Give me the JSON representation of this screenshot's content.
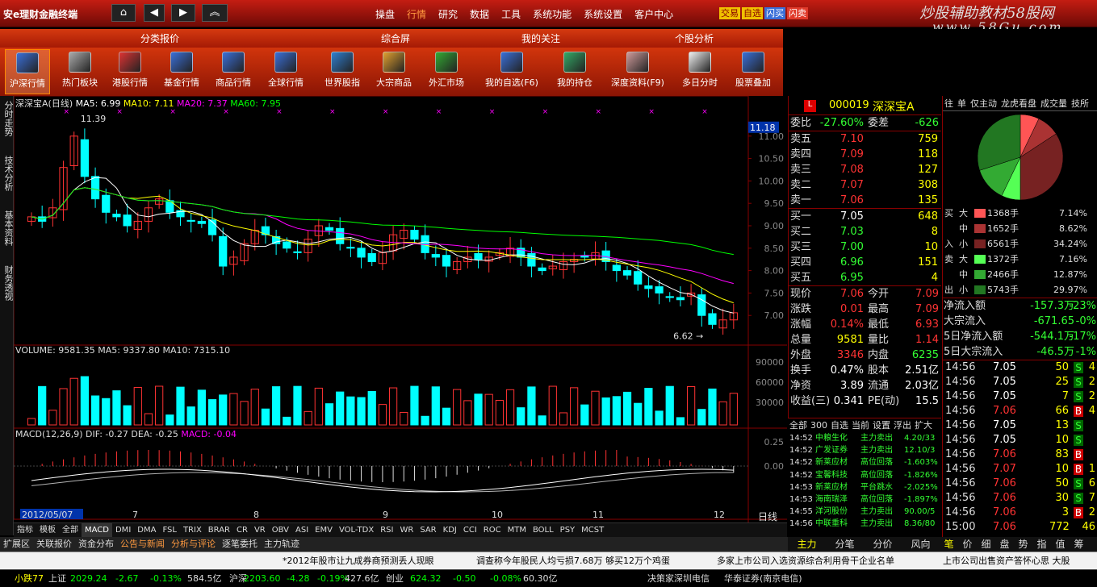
{
  "titlebar": {
    "app_title": "安e理财金融终端",
    "menu": [
      "操盘",
      "行情",
      "研究",
      "数据",
      "工具",
      "系统功能",
      "系统设置",
      "客户中心"
    ],
    "active_menu": "行情",
    "quick": [
      "交易",
      "自选",
      "闪买",
      "闪卖"
    ],
    "logo_line1": "炒股辅助教材58股网",
    "logo_line2": "www.58Gu.com"
  },
  "categories": [
    "分类报价",
    "综合屏",
    "我的关注",
    "个股分析"
  ],
  "toolbar": [
    {
      "label": "沪深行情",
      "icon": "chart-window-icon",
      "active": true
    },
    {
      "label": "热门板块",
      "icon": "funnel-icon"
    },
    {
      "label": "港股行情",
      "icon": "chart-window-icon"
    },
    {
      "label": "基金行情",
      "icon": "chart-window-icon"
    },
    {
      "label": "商品行情",
      "icon": "chart-window-icon"
    },
    {
      "label": "全球行情",
      "icon": "globe-icon"
    },
    {
      "label": "世界股指",
      "icon": "globe-chart-icon"
    },
    {
      "label": "大宗商品",
      "icon": "box-icon"
    },
    {
      "label": "外汇市场",
      "icon": "currency-icon"
    },
    {
      "label": "我的自选(F6)",
      "icon": "person-icon"
    },
    {
      "label": "我的持仓",
      "icon": "refresh-icon"
    },
    {
      "label": "深度资料(F9)",
      "icon": "document-icon"
    },
    {
      "label": "多日分时",
      "icon": "calendar-icon"
    },
    {
      "label": "股票叠加",
      "icon": "window-stack-icon"
    }
  ],
  "vtabs": [
    "分时走势",
    "技术分析",
    "基本资料",
    "财务透视"
  ],
  "chart": {
    "title": "深深宝A(日线)",
    "ma_legend": [
      {
        "label": "MA5:",
        "value": "6.99",
        "color": "#ffffff"
      },
      {
        "label": "MA10:",
        "value": "7.11",
        "color": "#ffff00"
      },
      {
        "label": "MA20:",
        "value": "7.37",
        "color": "#ff00ff"
      },
      {
        "label": "MA60:",
        "value": "7.95",
        "color": "#00ff00"
      }
    ],
    "price_axis": [
      "11.00",
      "10.50",
      "10.00",
      "9.50",
      "9.00",
      "8.50",
      "8.00",
      "7.50",
      "7.00"
    ],
    "current_price_tag": "11.18",
    "high_label": "11.39",
    "low_label": "6.62",
    "volume_title": "VOLUME: 9581.35  MA5: 9337.80  MA10: 7315.10",
    "volume_axis": [
      "90000",
      "60000",
      "30000"
    ],
    "macd_title_prefix": "MACD(12,26,9)",
    "macd_title_dif": "DIF: -0.27",
    "macd_title_dea": "DEA: -0.25",
    "macd_title_macd": "MACD: -0.04",
    "macd_axis": [
      "0.25",
      "0.00"
    ],
    "date_axis": [
      "2012/05/07",
      "7",
      "8",
      "9",
      "10",
      "11",
      "12"
    ],
    "period": "日线",
    "zoom": [
      "+",
      "-",
      "0"
    ]
  },
  "chart_data": {
    "type": "candlestick",
    "title": "深深宝A(日线)",
    "ylim": [
      6.5,
      11.5
    ],
    "close_approx": [
      9.2,
      9.1,
      9.4,
      10.3,
      11.0,
      10.1,
      9.6,
      9.3,
      9.2,
      9.0,
      9.1,
      9.4,
      9.6,
      9.3,
      9.2,
      9.1,
      9.05,
      8.8,
      8.1,
      8.3,
      8.6,
      8.9,
      8.8,
      8.6,
      8.5,
      8.4,
      8.7,
      9.0,
      8.9,
      8.6,
      8.5,
      8.3,
      8.2,
      8.4,
      8.8,
      8.9,
      8.7,
      8.4,
      8.3,
      8.1,
      8.2,
      8.3,
      8.25,
      8.3,
      8.4,
      8.5,
      8.3,
      8.1,
      8.0,
      8.1,
      8.2,
      8.25,
      8.3,
      8.4,
      8.2,
      8.0,
      7.9,
      7.7,
      7.6,
      7.5,
      7.4,
      7.35,
      7.5,
      7.0,
      6.8,
      6.9,
      7.06
    ],
    "ma5": 6.99,
    "ma10": 7.11,
    "ma20": 7.37,
    "ma60": 7.95,
    "high": 11.39,
    "low": 6.62
  },
  "quote": {
    "code": "000019",
    "name": "深深宝A",
    "webi": "-27.60%",
    "weicha": "-626",
    "sells": [
      {
        "lab": "卖五",
        "px": "7.10",
        "vol": "759"
      },
      {
        "lab": "卖四",
        "px": "7.09",
        "vol": "118"
      },
      {
        "lab": "卖三",
        "px": "7.08",
        "vol": "127"
      },
      {
        "lab": "卖二",
        "px": "7.07",
        "vol": "308"
      },
      {
        "lab": "卖一",
        "px": "7.06",
        "vol": "135"
      }
    ],
    "buys": [
      {
        "lab": "买一",
        "px": "7.05",
        "vol": "648"
      },
      {
        "lab": "买二",
        "px": "7.03",
        "vol": "8"
      },
      {
        "lab": "买三",
        "px": "7.00",
        "vol": "10"
      },
      {
        "lab": "买四",
        "px": "6.96",
        "vol": "151"
      },
      {
        "lab": "买五",
        "px": "6.95",
        "vol": "4"
      }
    ],
    "stats": [
      [
        "现价",
        "7.06",
        "今开",
        "7.09"
      ],
      [
        "涨跌",
        "0.01",
        "最高",
        "7.09"
      ],
      [
        "涨幅",
        "0.14%",
        "最低",
        "6.93"
      ],
      [
        "总量",
        "9581",
        "量比",
        "1.14"
      ],
      [
        "外盘",
        "3346",
        "内盘",
        "6235"
      ],
      [
        "换手",
        "0.47%",
        "股本",
        "2.51亿"
      ],
      [
        "净资",
        "3.89",
        "流通",
        "2.03亿"
      ],
      [
        "收益(三)",
        "0.341",
        "PE(动)",
        "15.5"
      ]
    ]
  },
  "monitor": {
    "tabs": [
      "全部",
      "300",
      "自选",
      "当前",
      "设置",
      "浮出",
      "扩大"
    ],
    "rows": [
      [
        "14:52",
        "中粮生化",
        "主力卖出",
        "4.20/33"
      ],
      [
        "14:52",
        "广发证券",
        "主力卖出",
        "12.10/3"
      ],
      [
        "14:52",
        "新莱应材",
        "高位回落",
        "-1.603%"
      ],
      [
        "14:52",
        "宝馨科技",
        "高位回落",
        "-1.826%"
      ],
      [
        "14:53",
        "新莱应材",
        "平台跳水",
        "-2.025%"
      ],
      [
        "14:53",
        "海南瑞泽",
        "高位回落",
        "-1.897%"
      ],
      [
        "14:55",
        "洋河股份",
        "主力卖出",
        "90.00/5"
      ],
      [
        "14:56",
        "中联重科",
        "主力卖出",
        "8.36/80"
      ]
    ]
  },
  "quote_tabs": [
    "主力",
    "分笔",
    "分价",
    "风向"
  ],
  "right": {
    "tabs": [
      "往",
      "单",
      "仅主动",
      "龙虎看盘",
      "成交量",
      "技所"
    ],
    "pie_slices": [
      0.0714,
      0.0862,
      0.3424,
      0.0716,
      0.1287,
      0.2997
    ],
    "flow_buy": [
      {
        "size": "大",
        "vol": "1368手",
        "pct": "7.14%",
        "color": "#ff5555"
      },
      {
        "size": "中",
        "vol": "1652手",
        "pct": "8.62%",
        "color": "#aa3333"
      },
      {
        "size": "小",
        "vol": "6561手",
        "pct": "34.24%",
        "color": "#772222"
      }
    ],
    "flow_sell": [
      {
        "size": "大",
        "vol": "1372手",
        "pct": "7.16%",
        "color": "#55ff55"
      },
      {
        "size": "中",
        "vol": "2466手",
        "pct": "12.87%",
        "color": "#33aa33"
      },
      {
        "size": "小",
        "vol": "5743手",
        "pct": "29.97%",
        "color": "#227722"
      }
    ],
    "flow_side_buy": [
      "买",
      "入"
    ],
    "flow_side_sell": [
      "卖",
      "出"
    ],
    "net": [
      {
        "k": "净流入额",
        "v": "-157.3万",
        "p": "-23%"
      },
      {
        "k": "大宗流入",
        "v": "-671.65",
        "p": "-0%"
      },
      {
        "k": "5日净流入额",
        "v": "-544.1万",
        "p": "-17%"
      },
      {
        "k": "5日大宗流入",
        "v": "-46.5万",
        "p": "-1%"
      }
    ],
    "ticks": [
      {
        "t": "14:56",
        "p": "7.05",
        "v": "50",
        "s": "S",
        "c": "green"
      },
      {
        "t": "14:56",
        "p": "7.05",
        "v": "25",
        "s": "S",
        "c": "green"
      },
      {
        "t": "14:56",
        "p": "7.05",
        "v": "7",
        "s": "S",
        "c": "green"
      },
      {
        "t": "14:56",
        "p": "7.06",
        "v": "66",
        "s": "B",
        "c": "red"
      },
      {
        "t": "14:56",
        "p": "7.05",
        "v": "13",
        "s": "S",
        "c": "green"
      },
      {
        "t": "14:56",
        "p": "7.05",
        "v": "10",
        "s": "S",
        "c": "green"
      },
      {
        "t": "14:56",
        "p": "7.06",
        "v": "83",
        "s": "B",
        "c": "red"
      },
      {
        "t": "14:56",
        "p": "7.07",
        "v": "10",
        "s": "B",
        "c": "red"
      },
      {
        "t": "14:56",
        "p": "7.06",
        "v": "50",
        "s": "S",
        "c": "green"
      },
      {
        "t": "14:56",
        "p": "7.06",
        "v": "30",
        "s": "S",
        "c": "green"
      },
      {
        "t": "14:56",
        "p": "7.06",
        "v": "3",
        "s": "B",
        "c": "red"
      },
      {
        "t": "15:00",
        "p": "7.06",
        "v": "772",
        "s": "",
        "c": "red"
      }
    ],
    "tick_extra": [
      "4",
      "2",
      "2",
      "4",
      "",
      "",
      "",
      "1",
      "6",
      "7",
      "2",
      "46"
    ],
    "bottom_tabs": [
      "笔",
      "价",
      "细",
      "盘",
      "势",
      "指",
      "值",
      "筹"
    ]
  },
  "indicator_tabs": [
    "指标",
    "模板",
    "全部",
    "MACD",
    "DMI",
    "DMA",
    "FSL",
    "TRIX",
    "BRAR",
    "CR",
    "VR",
    "OBV",
    "ASI",
    "EMV",
    "VOL-TDX",
    "RSI",
    "WR",
    "SAR",
    "KDJ",
    "CCI",
    "ROC",
    "MTM",
    "BOLL",
    "PSY",
    "MCST"
  ],
  "bottom_nav": [
    {
      "label": "扩展区",
      "hl": false
    },
    {
      "label": "关联报价",
      "hl": false
    },
    {
      "label": "资金分布",
      "hl": false
    },
    {
      "label": "公告与新闻",
      "hl": true
    },
    {
      "label": "分析与评论",
      "hl": true
    },
    {
      "label": "逐笔委托",
      "hl": false
    },
    {
      "label": "主力轨迹",
      "hl": false
    }
  ],
  "news": [
    "*2012年股市让九成券商预测丢人现眼",
    "调查称今年股民人均亏损7.68万 够买12万个鸡蛋",
    "多家上市公司入选资源综合利用骨干企业名单",
    "上市公司出售资产答怀心思 大股"
  ],
  "status": {
    "items": [
      {
        "text": "小跌77",
        "color": "#ffff00"
      },
      {
        "text": "上证",
        "color": "#dddddd"
      },
      {
        "text": "2029.24",
        "color": "#00ff00"
      },
      {
        "text": "-2.67",
        "color": "#00ff00"
      },
      {
        "text": "-0.13%",
        "color": "#00ff00"
      },
      {
        "text": "584.5亿",
        "color": "#dddddd"
      },
      {
        "text": "沪深",
        "color": "#dddddd"
      },
      {
        "text": "2203.60",
        "color": "#00ff00"
      },
      {
        "text": "-4.28",
        "color": "#00ff00"
      },
      {
        "text": "-0.19%",
        "color": "#00ff00"
      },
      {
        "text": "427.6亿",
        "color": "#dddddd"
      },
      {
        "text": "创业",
        "color": "#dddddd"
      },
      {
        "text": "624.32",
        "color": "#00ff00"
      },
      {
        "text": "-0.50",
        "color": "#00ff00"
      },
      {
        "text": "-0.08%",
        "color": "#00ff00"
      },
      {
        "text": "60.30亿",
        "color": "#dddddd"
      },
      {
        "text": "决策家深圳电信",
        "color": "#dddddd"
      },
      {
        "text": "华泰证券(南京电信)",
        "color": "#dddddd"
      }
    ]
  },
  "colors": {
    "up": "#ff3333",
    "down": "#00ffff",
    "ma5": "#ffffff",
    "ma10": "#ffff00",
    "ma20": "#ff00ff",
    "ma60": "#00ff00"
  }
}
